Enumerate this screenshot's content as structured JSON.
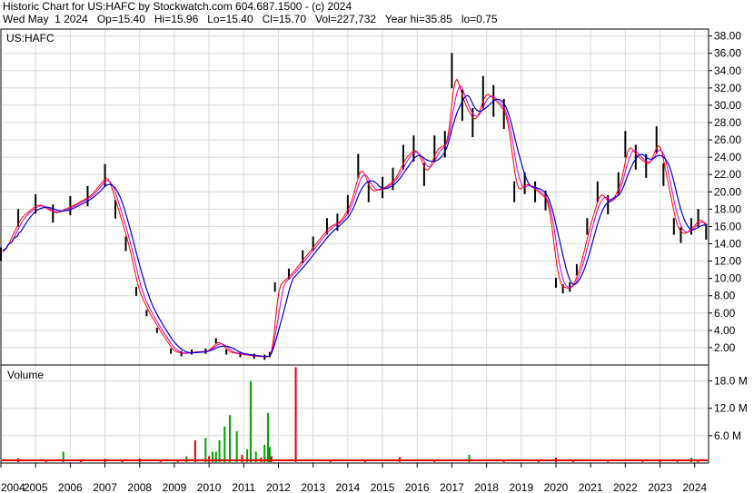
{
  "header": {
    "line1": "Historic Chart for US:HAFC by Stockwatch.com 604.687.1500 - (c) 2024",
    "line2": "Wed May  1 2024   Op=15.40   Hi=15.96   Lo=15.40   Cl=15.70   Vol=227,732   Year hi=35.85   lo=0.75"
  },
  "colors": {
    "price_bar": "#000000",
    "ma_short": "#ff0000",
    "ma_long": "#0000cc",
    "ma_mid": "#cc00cc",
    "volume_up": "#00a000",
    "volume_down": "#dd0000",
    "grid": "#d8d8d8"
  },
  "chart_data": [
    {
      "type": "line",
      "panel": "price",
      "title": "US:HAFC",
      "x_tick_labels": [
        "2004",
        "2005",
        "2006",
        "2007",
        "2008",
        "2009",
        "2010",
        "2011",
        "2012",
        "2013",
        "2014",
        "2015",
        "2016",
        "2017",
        "2018",
        "2019",
        "2020",
        "2021",
        "2022",
        "2023",
        "2024"
      ],
      "y_tick_labels": [
        "38.00",
        "36.00",
        "34.00",
        "32.00",
        "30.00",
        "28.00",
        "26.00",
        "24.00",
        "22.00",
        "20.00",
        "18.00",
        "16.00",
        "14.00",
        "12.00",
        "10.00",
        "8.00",
        "6.00",
        "4.00",
        "2.00"
      ],
      "ylim": [
        0,
        38.8
      ],
      "grid": true,
      "series": [
        {
          "x": [
            2004.0,
            2004.5,
            2005.0,
            2005.5,
            2006.0,
            2006.5,
            2007.0,
            2007.3,
            2007.6,
            2007.9,
            2008.2,
            2008.5,
            2008.9,
            2009.2,
            2009.5,
            2009.9,
            2010.2,
            2010.5,
            2010.9,
            2011.3,
            2011.6,
            2011.75,
            2011.9,
            2012.3,
            2012.7,
            2013.0,
            2013.4,
            2013.7,
            2014.0,
            2014.3,
            2014.6,
            2015.0,
            2015.3,
            2015.6,
            2015.9,
            2016.2,
            2016.5,
            2016.8,
            2017.0,
            2017.3,
            2017.6,
            2017.9,
            2018.2,
            2018.5,
            2018.8,
            2019.1,
            2019.4,
            2019.7,
            2020.0,
            2020.2,
            2020.4,
            2020.6,
            2020.9,
            2021.2,
            2021.5,
            2021.8,
            2022.0,
            2022.3,
            2022.6,
            2022.9,
            2023.1,
            2023.4,
            2023.6,
            2023.9,
            2024.1,
            2024.33
          ],
          "values": [
            12.8,
            17.0,
            18.6,
            17.5,
            18.4,
            19.5,
            21.9,
            18.0,
            14.0,
            8.5,
            6.0,
            4.0,
            1.6,
            1.3,
            1.5,
            1.6,
            2.8,
            1.5,
            1.2,
            1.0,
            0.9,
            1.2,
            9.0,
            10.5,
            12.5,
            14.0,
            16.0,
            16.5,
            18.5,
            23.0,
            20.0,
            20.5,
            21.5,
            24.0,
            25.0,
            22.0,
            25.0,
            25.5,
            34.0,
            30.0,
            28.0,
            31.5,
            30.5,
            29.0,
            20.0,
            21.0,
            20.0,
            19.0,
            9.5,
            8.8,
            9.0,
            11.0,
            16.0,
            20.0,
            18.5,
            21.0,
            25.5,
            24.0,
            23.0,
            26.0,
            22.0,
            16.0,
            15.0,
            16.0,
            17.0,
            15.4
          ]
        }
      ]
    },
    {
      "type": "bar",
      "panel": "volume",
      "title": "Volume",
      "y_tick_labels": [
        "18.0 M",
        "12.0 M",
        "6.0 M"
      ],
      "ylim": [
        0,
        21.5
      ],
      "grid": true,
      "x": [
        2004.5,
        2005.3,
        2005.8,
        2006.3,
        2007.0,
        2007.5,
        2008.0,
        2008.6,
        2009.1,
        2009.35,
        2009.6,
        2009.9,
        2010.0,
        2010.1,
        2010.2,
        2010.3,
        2010.45,
        2010.6,
        2010.8,
        2010.95,
        2011.1,
        2011.2,
        2011.35,
        2011.5,
        2011.6,
        2011.7,
        2011.75,
        2011.8,
        2012.5,
        2013.5,
        2014.5,
        2015.5,
        2016.5,
        2017.5,
        2018.5,
        2019.5,
        2020.0,
        2020.5,
        2021.5,
        2022.5,
        2023.0,
        2023.5,
        2023.9,
        2024.1
      ],
      "values": [
        1.0,
        0.6,
        2.5,
        0.8,
        0.9,
        0.6,
        1.0,
        0.7,
        0.8,
        1.5,
        5.0,
        5.5,
        1.5,
        2.5,
        2.5,
        5.0,
        8.0,
        10.5,
        7.0,
        1.8,
        3.0,
        18.0,
        2.5,
        1.2,
        4.0,
        11.0,
        3.5,
        1.5,
        21.0,
        0.4,
        0.6,
        1.3,
        0.5,
        1.8,
        0.8,
        0.5,
        1.2,
        0.6,
        0.6,
        0.7,
        0.6,
        0.7,
        1.2,
        0.6
      ],
      "volume_colors": [
        "red",
        "red",
        "green",
        "red",
        "red",
        "red",
        "red",
        "red",
        "red",
        "green",
        "red",
        "green",
        "red",
        "green",
        "green",
        "green",
        "green",
        "green",
        "green",
        "red",
        "green",
        "green",
        "green",
        "red",
        "green",
        "green",
        "green",
        "red",
        "red",
        "red",
        "red",
        "red",
        "red",
        "green",
        "red",
        "red",
        "red",
        "red",
        "red",
        "red",
        "red",
        "red",
        "green",
        "red"
      ]
    }
  ]
}
